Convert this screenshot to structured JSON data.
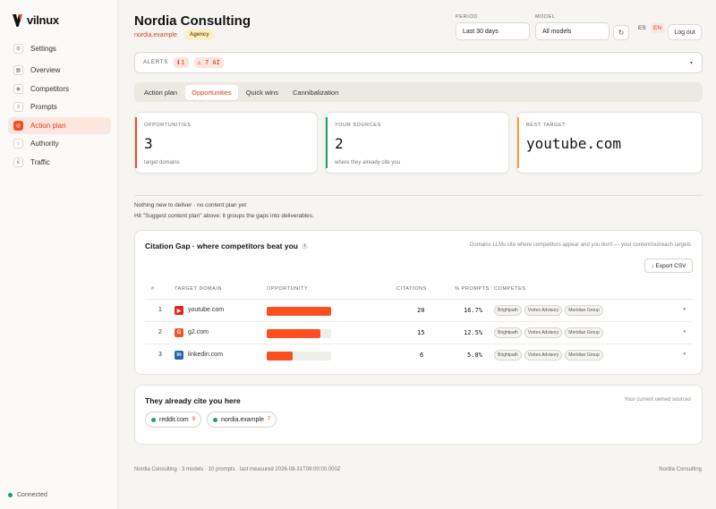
{
  "brand": {
    "name": "vilnux"
  },
  "nav": [
    {
      "label": "Settings",
      "icon": "gear-icon"
    },
    {
      "label": "Overview",
      "icon": "grid-icon"
    },
    {
      "label": "Competitors",
      "icon": "users-icon"
    },
    {
      "label": "Prompts",
      "icon": "list-icon"
    },
    {
      "label": "Action plan",
      "icon": "target-icon",
      "active": true
    },
    {
      "label": "Authority",
      "icon": "star-icon"
    },
    {
      "label": "Traffic",
      "icon": "chart-icon"
    }
  ],
  "status": {
    "connected": "Connected"
  },
  "header": {
    "title": "Nordia Consulting",
    "domain": "nordia.example",
    "badge": "Agency",
    "period_label": "PERIOD",
    "period_value": "Last 30 days",
    "model_label": "MODEL",
    "model_value": "All models",
    "lang_es": "ES",
    "lang_en": "EN",
    "logout": "Log out"
  },
  "alerts": {
    "label": "ALERTS",
    "count_badge": "ℹ 1",
    "ai_badge": "⚠ 7 AI"
  },
  "tabs": [
    "Action plan",
    "Opportunities",
    "Quick wins",
    "Cannibalization"
  ],
  "active_tab": "Opportunities",
  "cards": [
    {
      "label": "OPPORTUNITIES",
      "value": "3",
      "sub": "target domains",
      "accent": "#f04e23"
    },
    {
      "label": "YOUR SOURCES",
      "value": "2",
      "sub": "where they already cite you",
      "accent": "#22a06b"
    },
    {
      "label": "BEST TARGET",
      "value": "youtube.com",
      "sub": "",
      "accent": "#f0a040"
    }
  ],
  "notes": {
    "line1": "Nothing new to deliver · no content plan yet",
    "line2": "Hit \"Suggest content plan\" above: it groups the gaps into deliverables."
  },
  "citation_gap": {
    "title": "Citation Gap · where competitors beat you",
    "info": "i",
    "description": "Domains LLMs cite where competitors appear and you don't — your content/outreach targets",
    "export": "↓ Export CSV",
    "headers": {
      "num": "#",
      "domain": "TARGET DOMAIN",
      "opportunity": "OPPORTUNITY",
      "citations": "CITATIONS",
      "pct": "% PROMPTS",
      "competes": "COMPETES"
    },
    "rows": [
      {
        "rank": "1",
        "domain": "youtube.com",
        "favicon": "youtube-icon",
        "favicon_color": "#e62117",
        "opportunity": 1.0,
        "citations": "20",
        "pct": "16.7%",
        "competes": [
          "Brightpath",
          "Vortex Advisory",
          "Meridian Group"
        ]
      },
      {
        "rank": "2",
        "domain": "g2.com",
        "favicon": "g2-icon",
        "favicon_color": "#f0542d",
        "opportunity": 0.83,
        "citations": "15",
        "pct": "12.5%",
        "competes": [
          "Brightpath",
          "Vortex Advisory",
          "Meridian Group"
        ]
      },
      {
        "rank": "3",
        "domain": "linkedin.com",
        "favicon": "linkedin-icon",
        "favicon_color": "#2766a8",
        "opportunity": 0.4,
        "citations": "6",
        "pct": "5.0%",
        "competes": [
          "Brightpath",
          "Vortex Advisory",
          "Meridian Group"
        ]
      }
    ]
  },
  "already_cite": {
    "title": "They already cite you here",
    "description": "Your current owned sources",
    "sources": [
      {
        "domain": "reddit.com",
        "count": "9"
      },
      {
        "domain": "nordia.example",
        "count": "7"
      }
    ]
  },
  "footer": {
    "left": "Nordia Consulting · 3 models · 10 prompts · last measured 2026-08-31T09:00:00.000Z",
    "right": "Nordia Consulting"
  }
}
